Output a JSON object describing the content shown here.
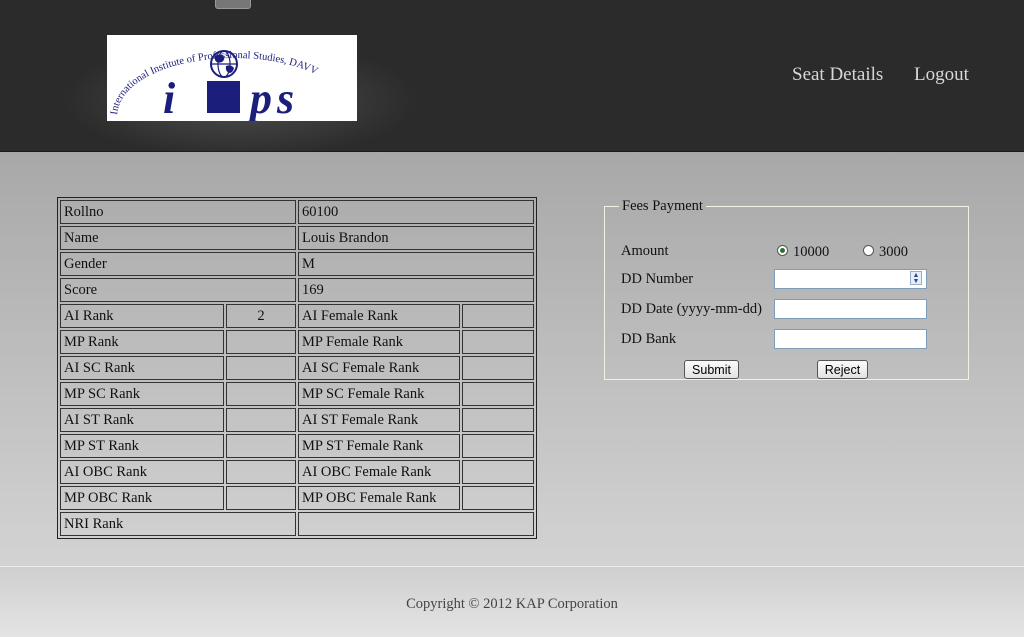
{
  "header": {
    "logo": {
      "letters": "iips",
      "arc_text": "International Institute of Professional Studies, DAVV"
    },
    "nav": [
      "Seat Details",
      "Logout"
    ]
  },
  "student": {
    "rows": [
      {
        "label": "Rollno",
        "value": "60100"
      },
      {
        "label": "Name",
        "value": "Louis Brandon"
      },
      {
        "label": "Gender",
        "value": "M"
      },
      {
        "label": "Score",
        "value": "169"
      }
    ],
    "ranks": [
      {
        "label": "AI Rank",
        "value": "2",
        "female_label": "AI Female Rank",
        "female_value": ""
      },
      {
        "label": "MP Rank",
        "value": "",
        "female_label": "MP Female Rank",
        "female_value": ""
      },
      {
        "label": "AI SC Rank",
        "value": "",
        "female_label": "AI SC Female Rank",
        "female_value": ""
      },
      {
        "label": "MP SC Rank",
        "value": "",
        "female_label": "MP SC Female Rank",
        "female_value": ""
      },
      {
        "label": "AI ST Rank",
        "value": "",
        "female_label": "AI ST Female Rank",
        "female_value": ""
      },
      {
        "label": "MP ST Rank",
        "value": "",
        "female_label": "MP ST Female Rank",
        "female_value": ""
      },
      {
        "label": "AI OBC Rank",
        "value": "",
        "female_label": "AI OBC Female Rank",
        "female_value": ""
      },
      {
        "label": "MP OBC Rank",
        "value": "",
        "female_label": "MP OBC Female Rank",
        "female_value": ""
      }
    ],
    "nri": {
      "label": "NRI Rank",
      "value": ""
    }
  },
  "fees": {
    "legend": "Fees Payment",
    "amount_label": "Amount",
    "amount_options": [
      "10000",
      "3000"
    ],
    "amount_selected": "10000",
    "dd_number_label": "DD Number",
    "dd_number_value": "",
    "dd_date_label": "DD Date (yyyy-mm-dd)",
    "dd_date_value": "",
    "dd_bank_label": "DD Bank",
    "dd_bank_value": "",
    "submit_label": "Submit",
    "reject_label": "Reject"
  },
  "footer": {
    "copyright": "Copyright © 2012 KAP Corporation"
  },
  "colors": {
    "header_bg": "#2b2b2b",
    "logo_blue": "#1c1e7c",
    "nav_text": "#d7d7d7",
    "radio_checked": "#2a6f2a"
  }
}
